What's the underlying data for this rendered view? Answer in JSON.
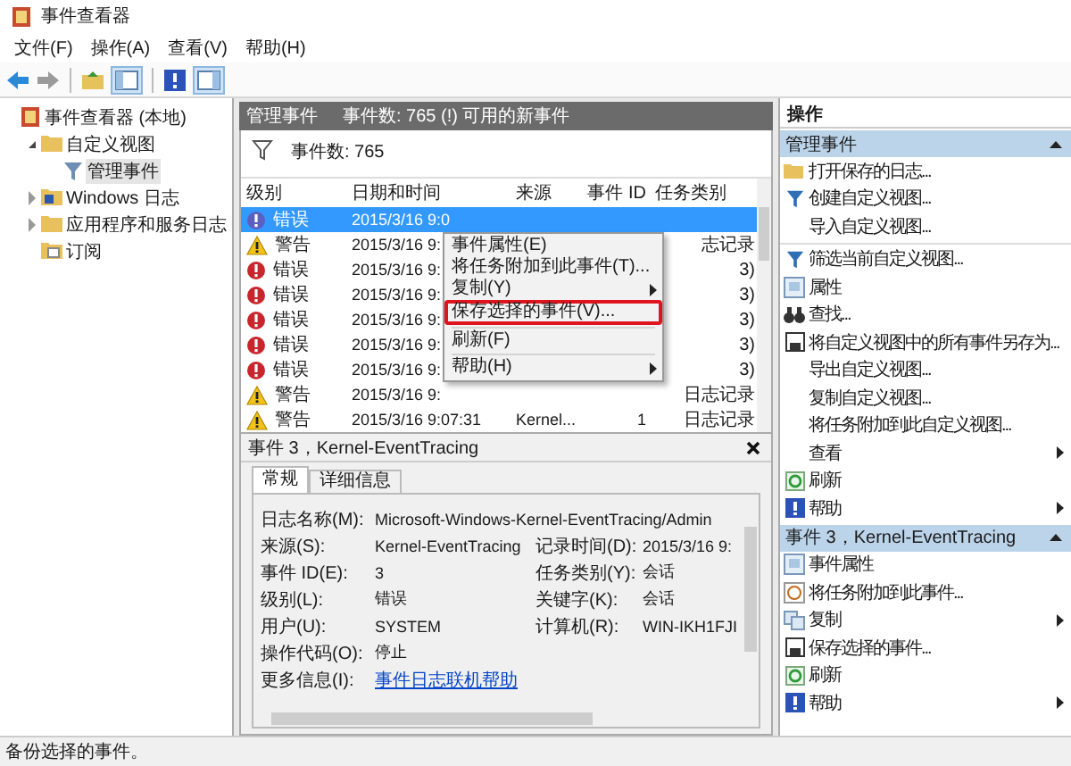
{
  "window": {
    "title": "事件查看器"
  },
  "menu": [
    "文件(F)",
    "操作(A)",
    "查看(V)",
    "帮助(H)"
  ],
  "tree": [
    {
      "label": "事件查看器 (本地)",
      "kind": "root",
      "selected": false,
      "children": [
        {
          "label": "自定义视图",
          "kind": "folder",
          "expanded": true,
          "selected": false,
          "children": [
            {
              "label": "管理事件",
              "kind": "filter",
              "selected": true
            }
          ]
        },
        {
          "label": "Windows 日志",
          "kind": "log",
          "expanded": false,
          "selected": false
        },
        {
          "label": "应用程序和服务日志",
          "kind": "folder",
          "expanded": false,
          "selected": false
        },
        {
          "label": "订阅",
          "kind": "subscription",
          "selected": false
        }
      ]
    }
  ],
  "center": {
    "title": "管理事件",
    "info": "事件数: 765 (!) 可用的新事件",
    "filter_text": "事件数: 765",
    "table": {
      "columns": [
        "级别",
        "日期和时间",
        "来源",
        "事件 ID",
        "任务类别"
      ],
      "rows": [
        {
          "kind": "error",
          "level": "错误",
          "date": "2015/3/16 9:0",
          "selected": true
        },
        {
          "kind": "warning",
          "level": "警告",
          "date": "2015/3/16 9:",
          "category": "志记录",
          "selected": false
        },
        {
          "kind": "error",
          "level": "错误",
          "date": "2015/3/16 9:",
          "category": "3)",
          "selected": false
        },
        {
          "kind": "error",
          "level": "错误",
          "date": "2015/3/16 9:",
          "category": "3)",
          "selected": false
        },
        {
          "kind": "error",
          "level": "错误",
          "date": "2015/3/16 9:",
          "category": "3)",
          "selected": false
        },
        {
          "kind": "error",
          "level": "错误",
          "date": "2015/3/16 9:",
          "category": "3)",
          "selected": false
        },
        {
          "kind": "error",
          "level": "错误",
          "date": "2015/3/16 9:",
          "category": "3)",
          "selected": false
        },
        {
          "kind": "warning",
          "level": "警告",
          "date": "2015/3/16 9:",
          "category": "日志记录",
          "selected": false
        },
        {
          "kind": "warning",
          "level": "警告",
          "date": "2015/3/16 9:07:31",
          "source": "Kernel...",
          "event_id": "1",
          "category": "日志记录",
          "selected": false
        }
      ]
    },
    "context_menu": [
      {
        "kind": "item",
        "label": "事件属性(E)",
        "outlined": false
      },
      {
        "kind": "item",
        "label": "将任务附加到此事件(T)...",
        "outlined": false
      },
      {
        "kind": "submenu",
        "label": "复制(Y)",
        "outlined": false
      },
      {
        "kind": "item",
        "label": "保存选择的事件(V)...",
        "outlined": true
      },
      {
        "kind": "separator"
      },
      {
        "kind": "item",
        "label": "刷新(F)",
        "outlined": false
      },
      {
        "kind": "separator"
      },
      {
        "kind": "submenu",
        "label": "帮助(H)",
        "outlined": false
      }
    ],
    "detail": {
      "title": "事件 3，Kernel-EventTracing",
      "tabs": [
        {
          "label": "常规",
          "selected": true
        },
        {
          "label": "详细信息",
          "selected": false
        }
      ],
      "fields": [
        {
          "kind": "text",
          "label": "日志名称(M):",
          "value": "Microsoft-Windows-Kernel-EventTracing/Admin"
        },
        {
          "kind": "text",
          "label": "来源(S):",
          "value": "Kernel-EventTracing",
          "label2": "记录时间(D):",
          "value2": "2015/3/16 9:"
        },
        {
          "kind": "text",
          "label": "事件 ID(E):",
          "value": "3",
          "label2": "任务类别(Y):",
          "value2": "会话"
        },
        {
          "kind": "text",
          "label": "级别(L):",
          "value": "错误",
          "label2": "关键字(K):",
          "value2": "会话"
        },
        {
          "kind": "text",
          "label": "用户(U):",
          "value": "SYSTEM",
          "label2": "计算机(R):",
          "value2": "WIN-IKH1FJI"
        },
        {
          "kind": "text",
          "label": "操作代码(O):",
          "value": "停止"
        },
        {
          "kind": "link",
          "label": "更多信息(I):",
          "value": "事件日志联机帮助"
        }
      ]
    }
  },
  "actions": {
    "title": "操作",
    "sections": [
      {
        "title": "管理事件",
        "expanded": true,
        "items": [
          {
            "kind": "open",
            "label": "打开保存的日志..."
          },
          {
            "kind": "filter",
            "label": "创建自定义视图..."
          },
          {
            "kind": "plain",
            "label": "导入自定义视图..."
          },
          {
            "kind": "separator"
          },
          {
            "kind": "filter",
            "label": "筛选当前自定义视图..."
          },
          {
            "kind": "props",
            "label": "属性"
          },
          {
            "kind": "find",
            "label": "查找..."
          },
          {
            "kind": "save",
            "label": "将自定义视图中的所有事件另存为..."
          },
          {
            "kind": "plain",
            "label": "导出自定义视图..."
          },
          {
            "kind": "plain",
            "label": "复制自定义视图..."
          },
          {
            "kind": "plain",
            "label": "将任务附加到此自定义视图..."
          },
          {
            "kind": "plain",
            "label": "查看",
            "submenu": true
          },
          {
            "kind": "refresh",
            "label": "刷新"
          },
          {
            "kind": "help",
            "label": "帮助",
            "submenu": true
          }
        ]
      },
      {
        "title": "事件 3，Kernel-EventTracing",
        "expanded": true,
        "items": [
          {
            "kind": "props",
            "label": "事件属性"
          },
          {
            "kind": "attach",
            "label": "将任务附加到此事件..."
          },
          {
            "kind": "copy",
            "label": "复制",
            "submenu": true
          },
          {
            "kind": "save",
            "label": "保存选择的事件..."
          },
          {
            "kind": "refresh",
            "label": "刷新"
          },
          {
            "kind": "help",
            "label": "帮助",
            "submenu": true
          }
        ]
      }
    ]
  },
  "status_bar": "备份选择的事件。"
}
